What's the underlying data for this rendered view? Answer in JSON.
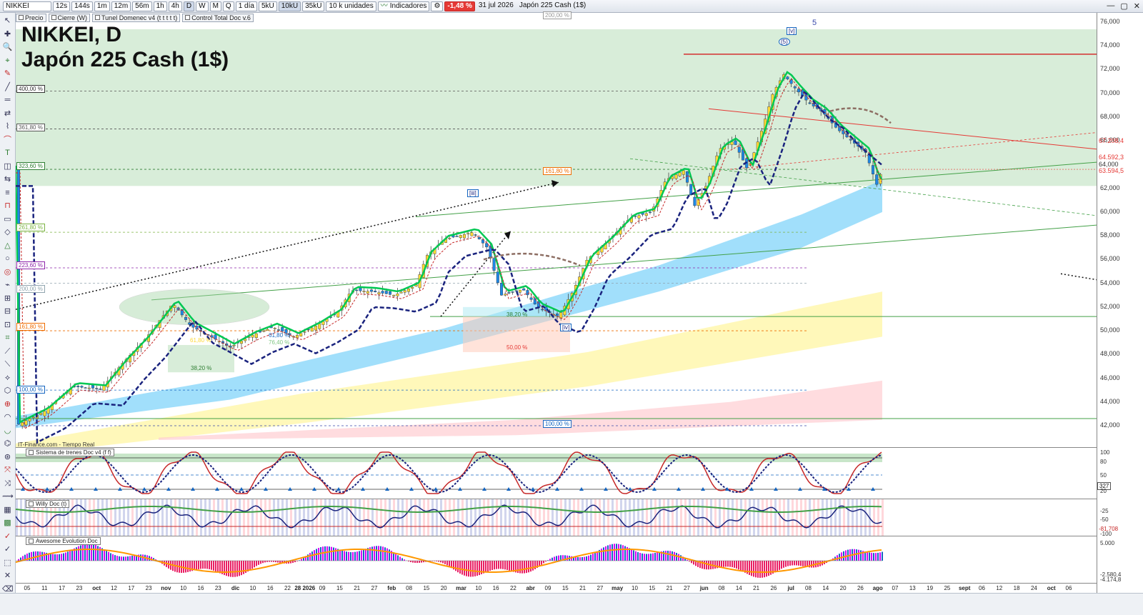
{
  "toolbar": {
    "symbol": "NIKKEI",
    "timeframes": [
      "12s",
      "144s",
      "1m",
      "12m",
      "56m",
      "1h",
      "4h",
      "D",
      "W",
      "M",
      "Q"
    ],
    "selected_timeframe": "D",
    "period": "1 día",
    "units": [
      "5kU",
      "10kU",
      "35kU"
    ],
    "units_selected": "10kU",
    "units_dropdown": "10 k unidades",
    "indicators_label": "Indicadores",
    "change": "-1,48 %",
    "date": "31 jul 2026",
    "instrument": "Japón 225 Cash (1$)"
  },
  "overlays": [
    "Precio",
    "Cierre (W)",
    "Tunel Domenec v4 (t t t t t)",
    "Control Total Doc v.6"
  ],
  "title": {
    "line1": "NIKKEI, D",
    "line2": "Japón 225 Cash (1$)"
  },
  "source": "IT-Finance.com - Tiempo Real",
  "fib_left": [
    "400,00 %",
    "361,80 %",
    "323,60 %",
    "261,80 %",
    "223,60 %",
    "200,00 %",
    "161,80 %",
    "100,00 %"
  ],
  "fib_mid": {
    "top": "200,00 %",
    "box": "161,80 %",
    "bottom": "100,00 %"
  },
  "retracements": [
    "61,80 %",
    "38,20 %",
    "76,40 %",
    "38,20 %",
    "50,00 %",
    "61,80 %"
  ],
  "wave_labels": {
    "iii": "[iii]",
    "iv": "[iv]",
    "v": "[v]",
    "five": "(5)",
    "top5": "5"
  },
  "price_axis": [
    "76,000",
    "74,000",
    "72,000",
    "70,000",
    "68,000",
    "66,000",
    "64,000",
    "62,000",
    "60,000",
    "58,000",
    "56,000",
    "54,000",
    "52,000",
    "50,000",
    "48,000",
    "46,000",
    "44,000",
    "42,000"
  ],
  "price_tags": {
    "p1": "67.208,4",
    "p2": "64.592,3",
    "p3": "63.594,5",
    "p4": "64,000"
  },
  "panes": {
    "trenes": {
      "title": "Sistema de trenes Doc v4 (f f)",
      "axis": [
        "100",
        "80",
        "50",
        "20"
      ],
      "tag": "327"
    },
    "willy": {
      "title": "Willy Doc (t)",
      "axis": [
        "-25",
        "-50",
        "-100"
      ],
      "tag": "-81,708"
    },
    "awesome": {
      "title": "Awesome Evolution Doc",
      "axis": [
        "5.000",
        "-2.580,4",
        "-4.174,8"
      ]
    }
  },
  "x_axis": [
    "05",
    "11",
    "17",
    "23",
    "oct",
    "12",
    "17",
    "23",
    "nov",
    "10",
    "16",
    "23",
    "dic",
    "10",
    "16",
    "22",
    "28 2026",
    "09",
    "15",
    "21",
    "27",
    "feb",
    "08",
    "15",
    "20",
    "mar",
    "10",
    "16",
    "22",
    "abr",
    "09",
    "15",
    "21",
    "27",
    "may",
    "10",
    "15",
    "21",
    "27",
    "jun",
    "08",
    "14",
    "21",
    "26",
    "jul",
    "08",
    "14",
    "20",
    "26",
    "ago",
    "07",
    "13",
    "19",
    "25",
    "sept",
    "06",
    "12",
    "18",
    "24",
    "oct",
    "06"
  ],
  "colors": {
    "accent": "#e53935",
    "green_zone": "#c8e6c9",
    "blue_band": "#81d4fa",
    "yellow_band": "#fff59d",
    "pink_band": "#ffcdd2"
  }
}
